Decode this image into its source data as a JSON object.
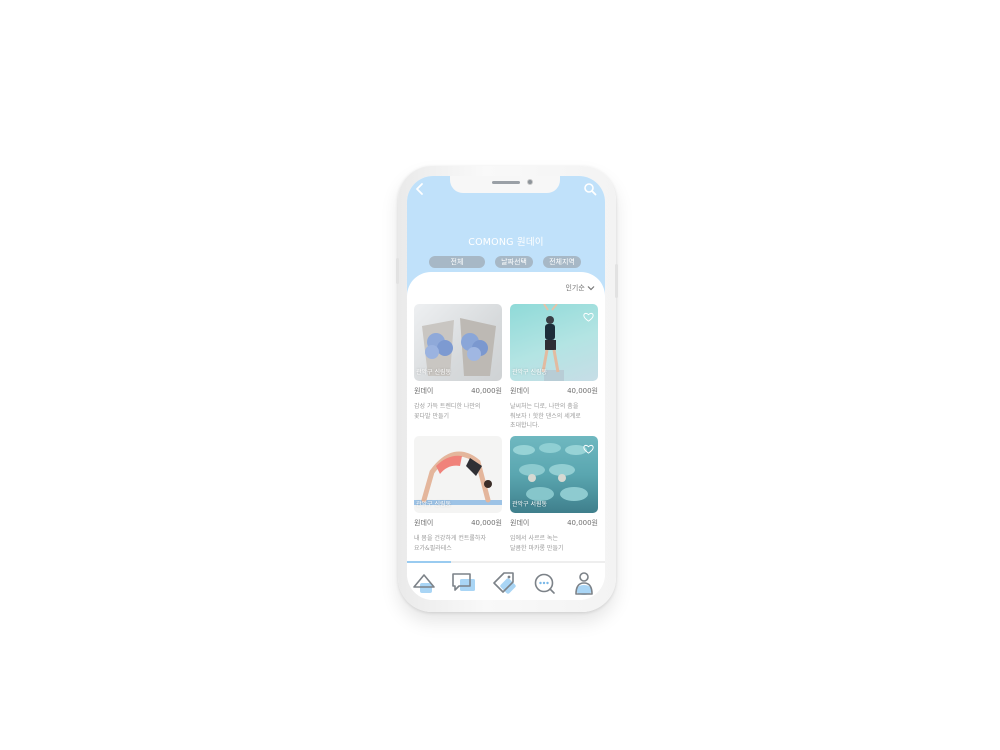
{
  "header": {
    "title": "COMONG 원데이",
    "back_icon": "chevron-left-icon",
    "search_icon": "search-icon"
  },
  "filters": [
    {
      "label": "전체"
    },
    {
      "label": "날짜선택"
    },
    {
      "label": "전체지역"
    }
  ],
  "sort": {
    "label": "인기순",
    "icon": "chevron-down-icon"
  },
  "cards": [
    {
      "location": "관악구 신림동",
      "name": "원데이",
      "price": "40,000원",
      "desc": "감성 가득 트렌디한 나만의\n꽃다발 만들기",
      "image": "blue-flower-bouquet"
    },
    {
      "location": "관악구 신림동",
      "name": "원데이",
      "price": "40,000원",
      "desc": "날씨처는 디로, 나만의 춤을\n춰보자 ! 핫한 댄스의 세계로\n초대합니다.",
      "image": "dancer"
    },
    {
      "location": "관악구 신림동",
      "name": "원데이",
      "price": "40,000원",
      "desc": "내 몸을 건강하게 컨트롤하자\n요가&필라테스",
      "image": "yoga-backbend"
    },
    {
      "location": "관악구 서원동",
      "name": "원데이",
      "price": "40,000원",
      "desc": "입에서 사르르 녹는\n달콤한 마카롱 만들기",
      "image": "macarons"
    }
  ],
  "scroll_progress": 0.22,
  "tabs": [
    {
      "icon": "home-icon"
    },
    {
      "icon": "chat-icon"
    },
    {
      "icon": "tag-icon"
    },
    {
      "icon": "more-chat-icon"
    },
    {
      "icon": "profile-icon"
    }
  ],
  "colors": {
    "header_bg": "#c0e1fa",
    "accent": "#99cbf0",
    "filter_chip": "#a7b8c6",
    "icon_stroke": "#7c8288"
  }
}
